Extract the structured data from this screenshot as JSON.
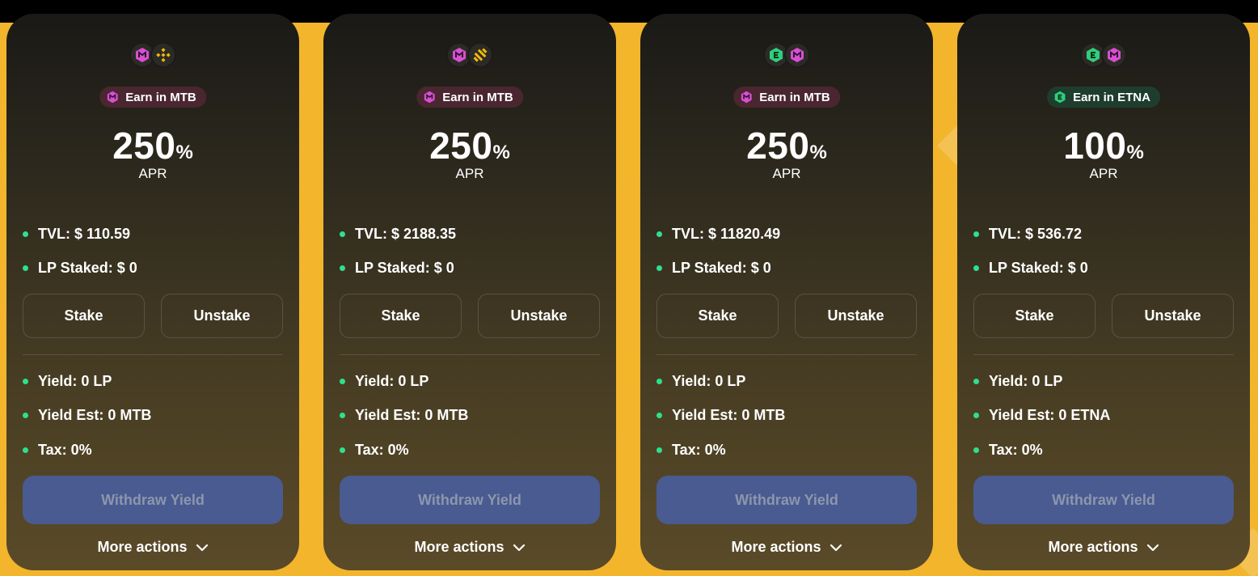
{
  "cards": [
    {
      "tokens": [
        "mtb-token-icon",
        "bnb-token-icon"
      ],
      "earn_label": "Earn in MTB",
      "earn_token": "mtb",
      "apr_value": "250",
      "apr_unit": "%",
      "apr_label": "APR",
      "tvl": "TVL: $ 110.59",
      "lp_staked": "LP Staked: $ 0",
      "stake_label": "Stake",
      "unstake_label": "Unstake",
      "yield": "Yield: 0 LP",
      "yield_est": "Yield Est: 0 MTB",
      "tax": "Tax: 0%",
      "withdraw_label": "Withdraw Yield",
      "more_label": "More actions"
    },
    {
      "tokens": [
        "mtb-token-icon",
        "busd-token-icon"
      ],
      "earn_label": "Earn in MTB",
      "earn_token": "mtb",
      "apr_value": "250",
      "apr_unit": "%",
      "apr_label": "APR",
      "tvl": "TVL: $ 2188.35",
      "lp_staked": "LP Staked: $ 0",
      "stake_label": "Stake",
      "unstake_label": "Unstake",
      "yield": "Yield: 0 LP",
      "yield_est": "Yield Est: 0 MTB",
      "tax": "Tax: 0%",
      "withdraw_label": "Withdraw Yield",
      "more_label": "More actions"
    },
    {
      "tokens": [
        "etna-token-icon",
        "mtb-token-icon"
      ],
      "earn_label": "Earn in MTB",
      "earn_token": "mtb",
      "apr_value": "250",
      "apr_unit": "%",
      "apr_label": "APR",
      "tvl": "TVL: $ 11820.49",
      "lp_staked": "LP Staked: $ 0",
      "stake_label": "Stake",
      "unstake_label": "Unstake",
      "yield": "Yield: 0 LP",
      "yield_est": "Yield Est: 0 MTB",
      "tax": "Tax: 0%",
      "withdraw_label": "Withdraw Yield",
      "more_label": "More actions"
    },
    {
      "tokens": [
        "etna-token-icon",
        "mtb-token-icon"
      ],
      "earn_label": "Earn in ETNA",
      "earn_token": "etna",
      "apr_value": "100",
      "apr_unit": "%",
      "apr_label": "APR",
      "tvl": "TVL: $ 536.72",
      "lp_staked": "LP Staked: $ 0",
      "stake_label": "Stake",
      "unstake_label": "Unstake",
      "yield": "Yield: 0 LP",
      "yield_est": "Yield Est: 0 ETNA",
      "tax": "Tax: 0%",
      "withdraw_label": "Withdraw Yield",
      "more_label": "More actions"
    }
  ],
  "colors": {
    "page_background": "#f2b52c",
    "bullet": "#2ee08e",
    "withdraw_button": "#495b90",
    "withdraw_text_disabled": "#8d96ad",
    "mtb_brand": "#d94fd0",
    "etna_brand": "#2ecf7a",
    "bnb_brand": "#f0b90b"
  }
}
